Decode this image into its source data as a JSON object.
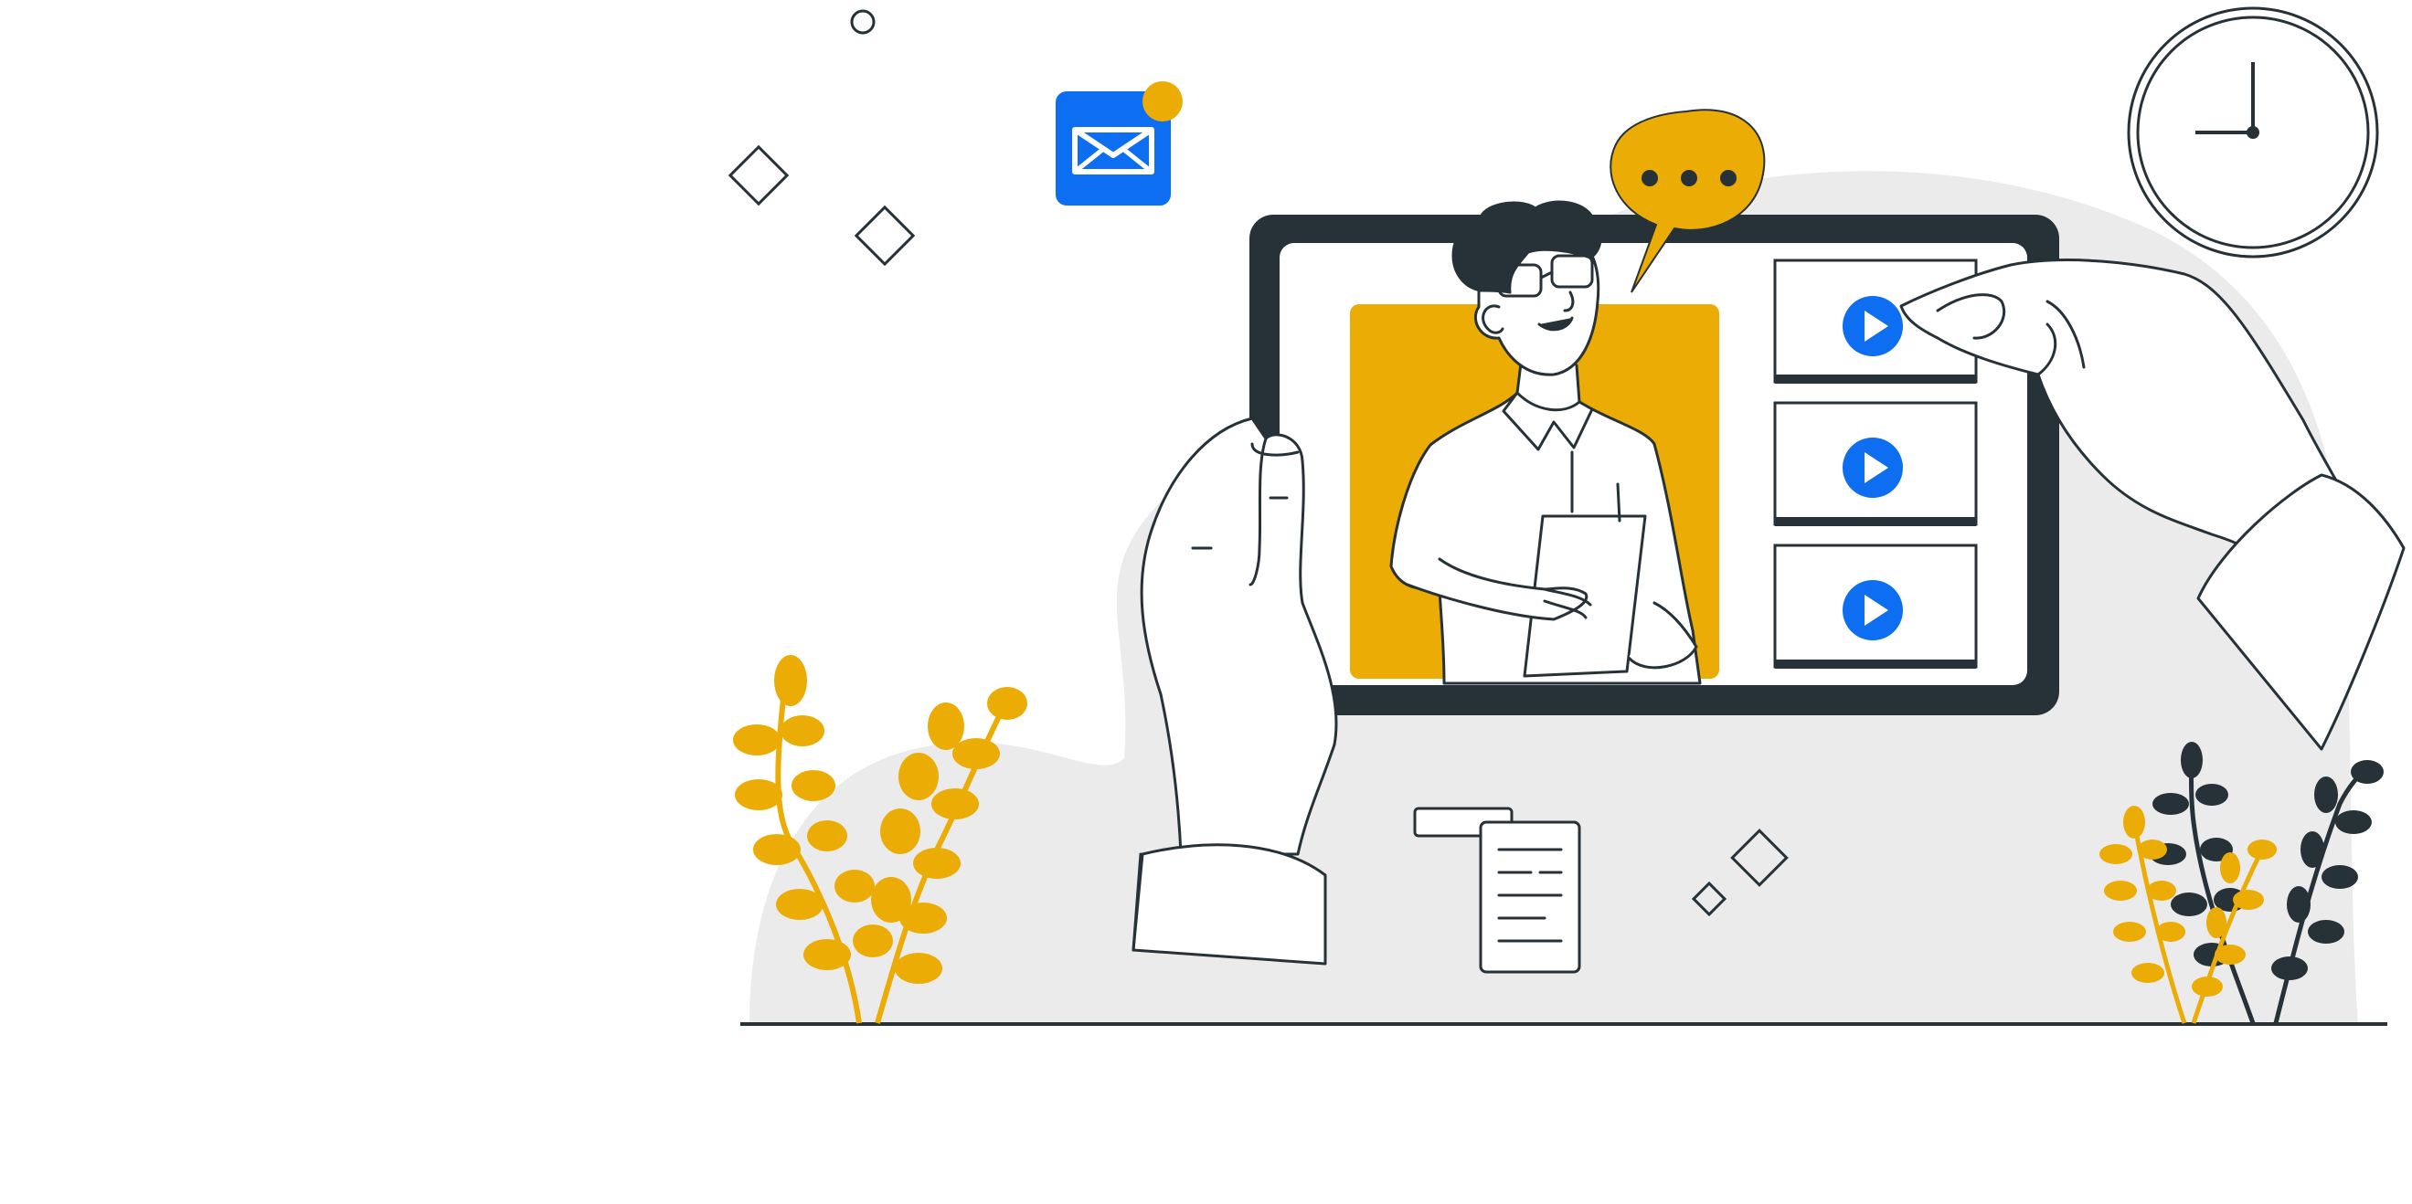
{
  "colors": {
    "background": "#ffffff",
    "blob": "#ebebeb",
    "dark": "#263238",
    "yellow": "#ebac06",
    "blue": "#0e6ef1",
    "white": "#ffffff",
    "line": "#263238"
  },
  "icons": [
    "envelope-icon",
    "notification-dot-icon",
    "chat-bubble-icon",
    "clock-icon",
    "play-icon",
    "document-icon",
    "plant-icon",
    "diamond-icon"
  ],
  "video_list": {
    "count": 3
  },
  "chat_bubble": {
    "dots": 3
  }
}
